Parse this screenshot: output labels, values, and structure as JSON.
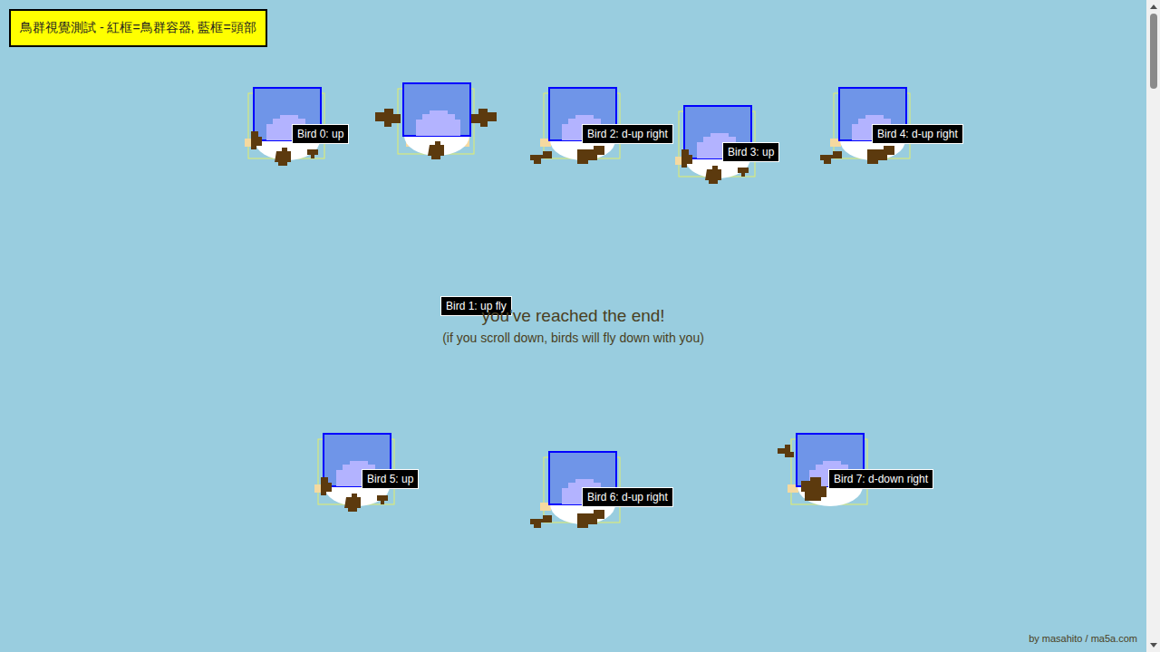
{
  "header": {
    "title": "鳥群視覺測試 - 紅框=鳥群容器, 藍框=頭部"
  },
  "birds": [
    {
      "label": "Bird 0: up",
      "kind": "up"
    },
    {
      "label": "Bird 1: up fly",
      "kind": "fly"
    },
    {
      "label": "Bird 2: d-up right",
      "kind": "right"
    },
    {
      "label": "Bird 3: up",
      "kind": "up"
    },
    {
      "label": "Bird 4: d-up right",
      "kind": "right"
    },
    {
      "label": "Bird 5: up",
      "kind": "up"
    },
    {
      "label": "Bird 6: d-up right",
      "kind": "right"
    },
    {
      "label": "Bird 7: d-down right",
      "kind": "down"
    }
  ],
  "end_message": {
    "title": "you've reached the end!",
    "subtitle": "(if you scroll down, birds will fly down with you)"
  },
  "credit": "by masahito / ma5a.com",
  "scrollbar": {
    "level": 0.12
  }
}
